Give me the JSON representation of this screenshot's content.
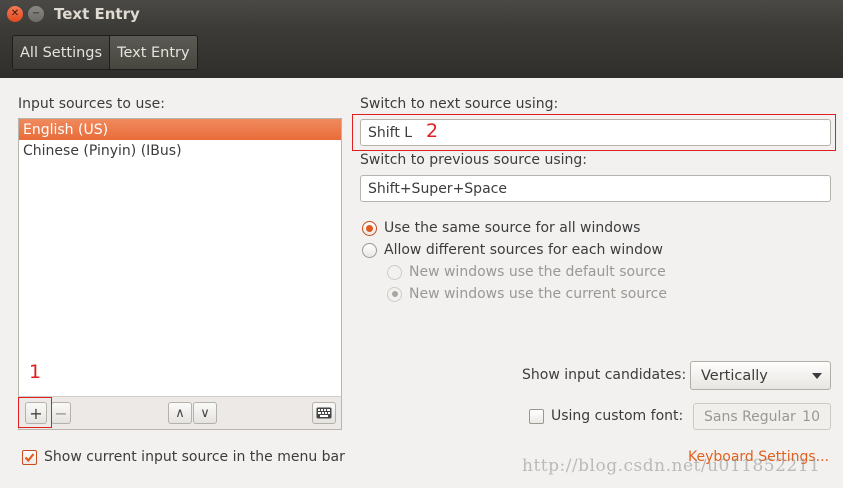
{
  "window": {
    "title": "Text Entry"
  },
  "toolbar": {
    "breadcrumbs": [
      "All Settings",
      "Text Entry"
    ]
  },
  "input_sources": {
    "label": "Input sources to use:",
    "items": [
      "English (US)",
      "Chinese (Pinyin) (IBus)"
    ],
    "selected_index": 0,
    "add_glyph": "+",
    "remove_glyph": "−",
    "up_glyph": "∧",
    "down_glyph": "∨"
  },
  "switch": {
    "next_label": "Switch to next source using:",
    "next_value": "Shift L",
    "prev_label": "Switch to previous source using:",
    "prev_value": "Shift+Super+Space"
  },
  "radios": {
    "same_source": "Use the same source for all windows",
    "different_sources": "Allow different sources for each window",
    "default_source": "New windows use the default source",
    "current_source": "New windows use the current source"
  },
  "candidates": {
    "label": "Show input candidates:",
    "value": "Vertically"
  },
  "custom_font": {
    "label": "Using custom font:",
    "font": "Sans Regular",
    "size": "10"
  },
  "show_current": {
    "label": "Show current input source in the menu bar",
    "checked": true
  },
  "link": {
    "keyboard_settings": "Keyboard Settings..."
  },
  "annotations": [
    "1",
    "2"
  ],
  "watermark": "http://blog.csdn.net/u011852211",
  "colors": {
    "accent": "#e86c3a",
    "annotation": "#e02020",
    "titlebar": "#3c3b37"
  }
}
